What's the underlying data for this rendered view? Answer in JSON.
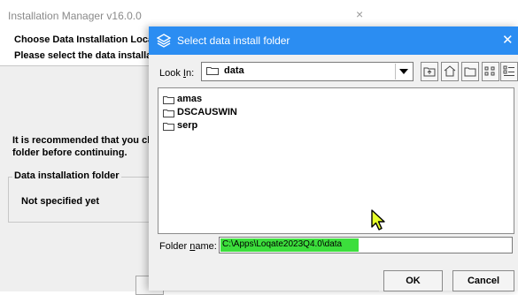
{
  "installer": {
    "title": "Installation Manager v16.0.0",
    "close_glyph": "×",
    "header_line1": "Choose Data Installation Locatio",
    "header_line2": "Please select the data installatio",
    "recommend_line1": "It is recommended that you close",
    "recommend_line2": "folder before continuing.",
    "group_label": "Data installation folder",
    "folder_status": "Not specified yet"
  },
  "dialog": {
    "title": "Select data install folder",
    "close_glyph": "✕",
    "look_in_label_pre": "Look ",
    "look_in_label_mnemonic": "I",
    "look_in_label_post": "n:",
    "look_in_value": "data",
    "toolbar_icons": [
      "up-one-level-icon",
      "home-icon",
      "new-folder-icon",
      "list-view-icon",
      "details-view-icon"
    ],
    "files": [
      {
        "name": "amas",
        "icon": "folder-icon"
      },
      {
        "name": "DSCAUSWIN",
        "icon": "folder-icon"
      },
      {
        "name": "serp",
        "icon": "folder-icon"
      }
    ],
    "folder_name_label_pre": "Folder ",
    "folder_name_label_mnemonic": "n",
    "folder_name_label_post": "ame:",
    "folder_name_value": "C:\\Apps\\Loqate2023Q4.0\\data",
    "ok_label": "OK",
    "cancel_label": "Cancel"
  },
  "colors": {
    "titlebar": "#2b8df2",
    "highlight": "#3cde3c",
    "dialog_bg": "#f0f0f0",
    "installer_body": "#efefef"
  }
}
